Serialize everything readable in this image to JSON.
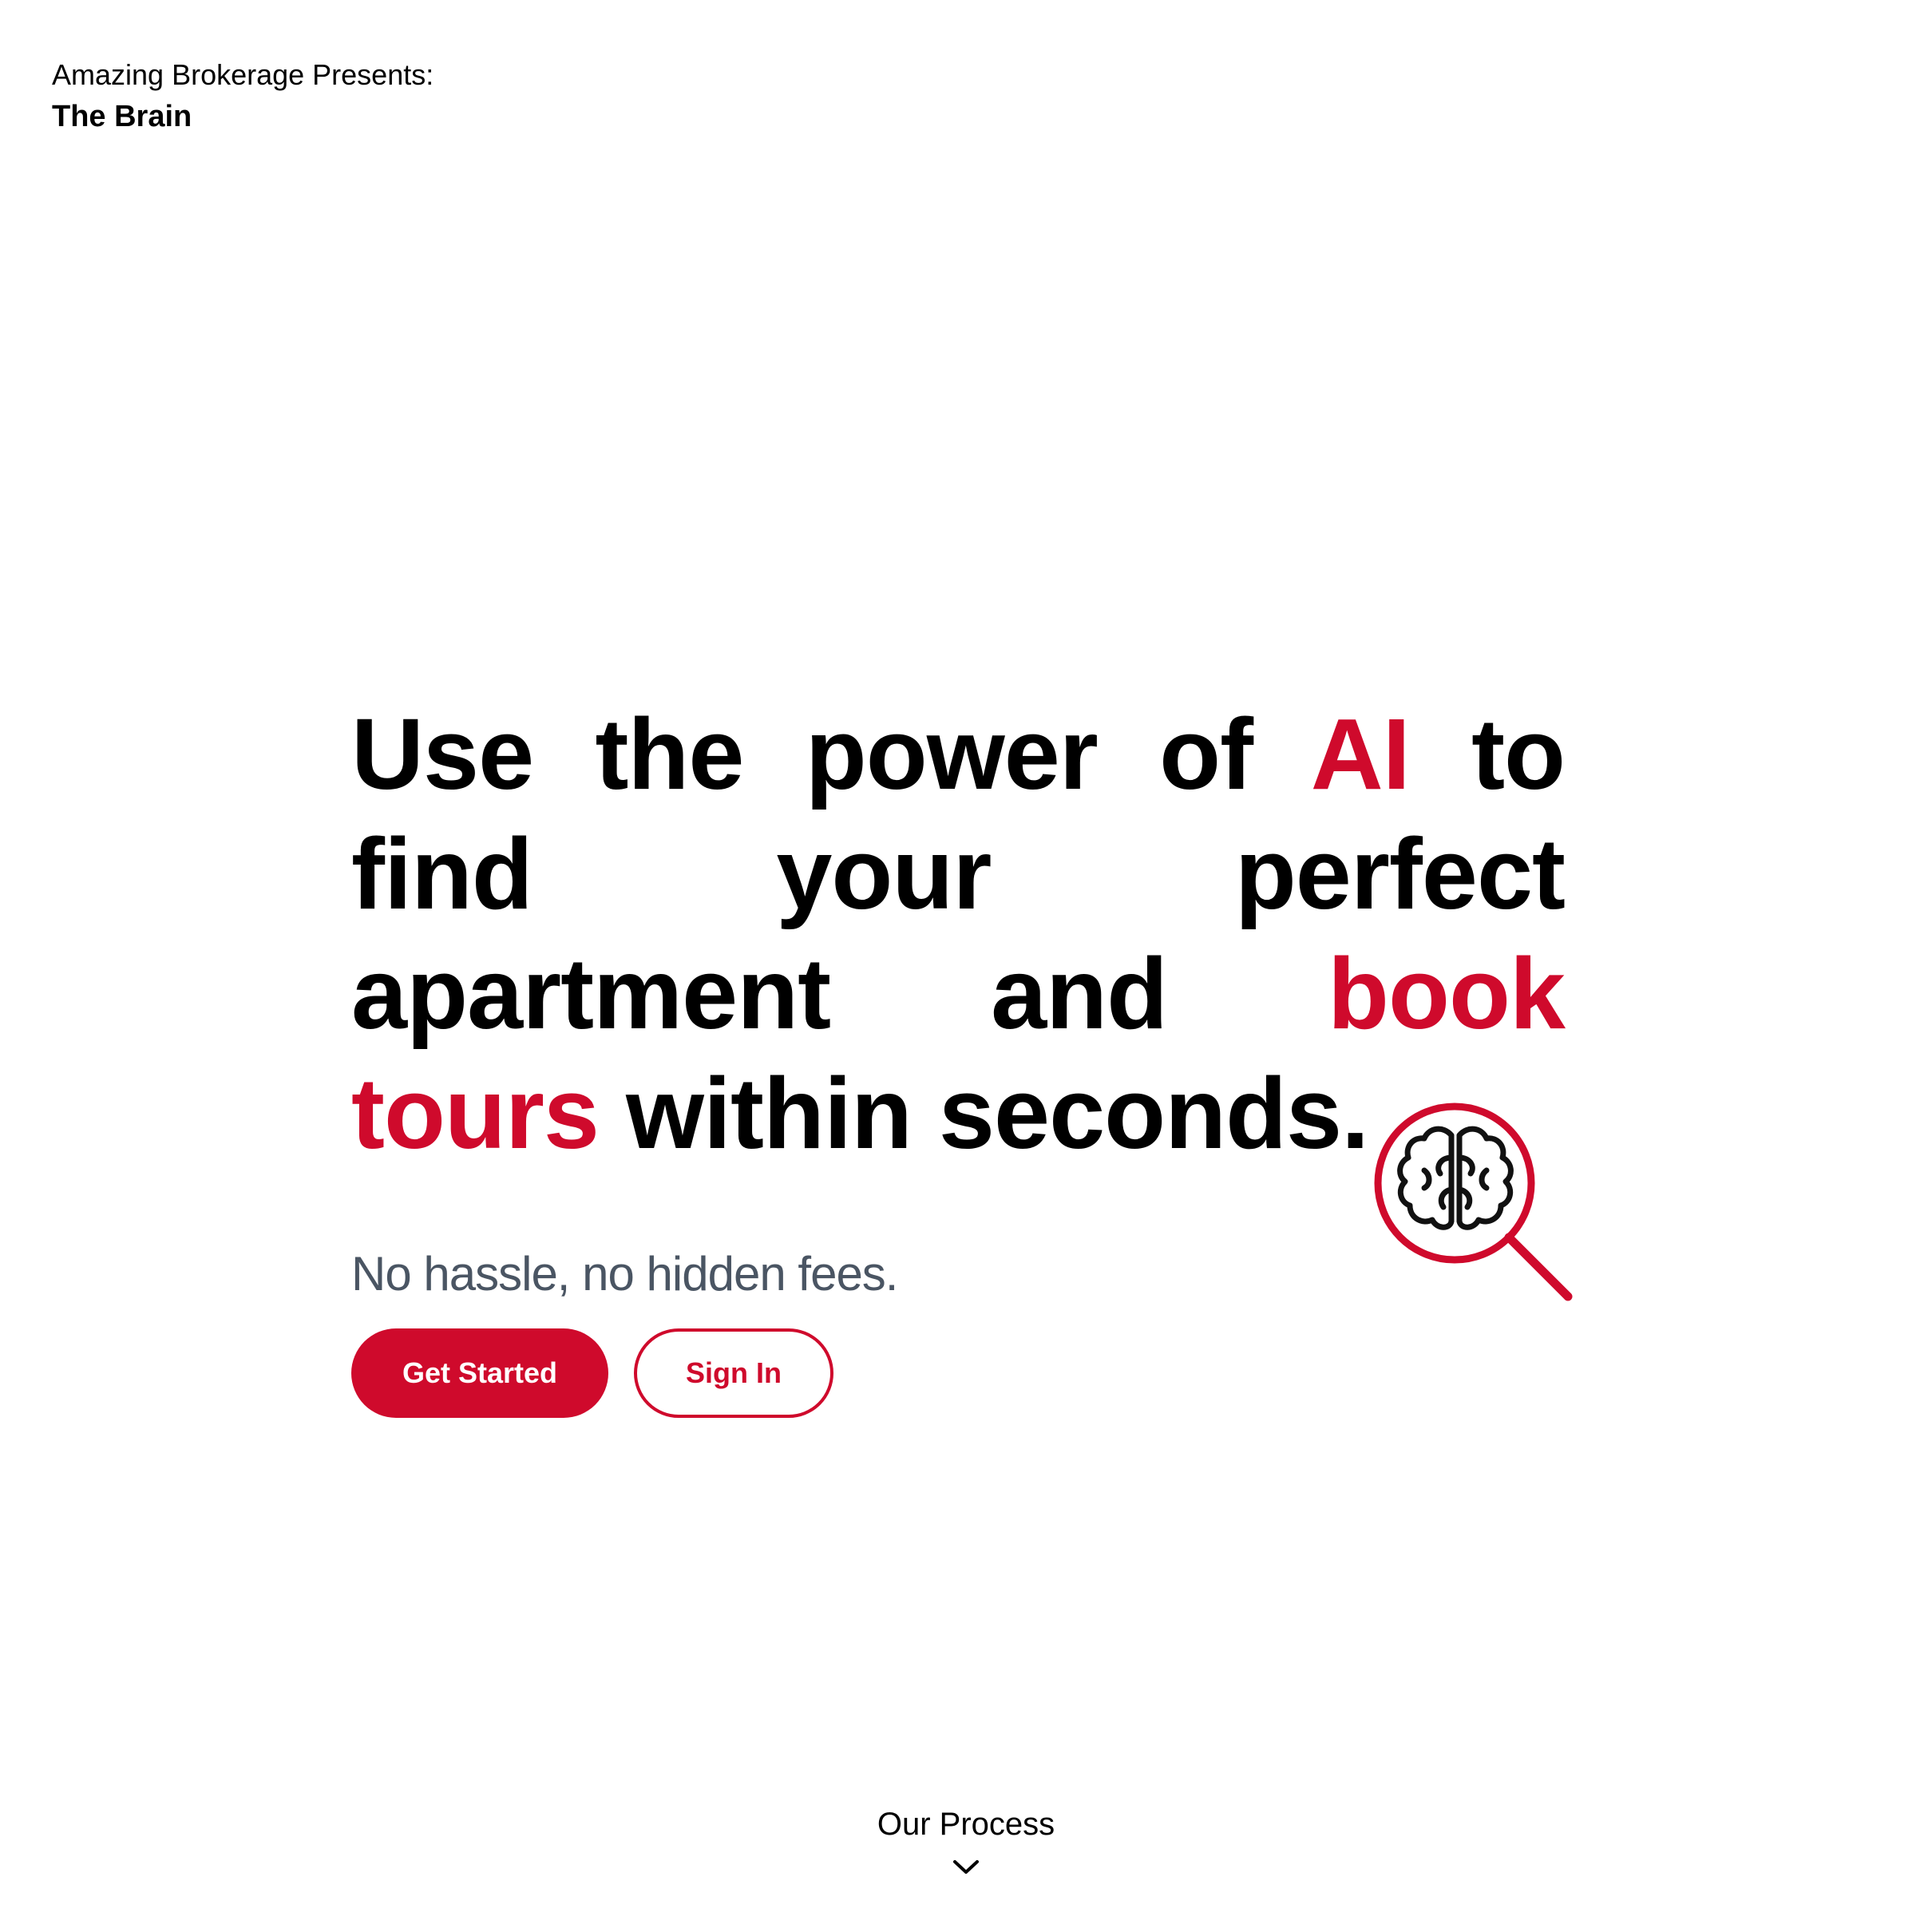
{
  "brand": {
    "presents": "Amazing Brokerage Presents:",
    "name": "The Brain"
  },
  "hero": {
    "headline": {
      "part1": "Use the power of ",
      "accent1": "AI",
      "part2": " to find your perfect apartment and ",
      "accent2": "book tours",
      "part3": " within seconds."
    },
    "subline": "No hassle, no hidden fees.",
    "primary_button": "Get Started",
    "secondary_button": "Sign In"
  },
  "footer": {
    "process_label": "Our Process"
  },
  "icons": {
    "hero_icon": "brain-magnifier-icon",
    "scroll_icon": "chevron-down-icon"
  },
  "colors": {
    "accent": "#cf0a2c",
    "text": "#000000",
    "muted": "#4a5563",
    "background": "#ffffff"
  }
}
